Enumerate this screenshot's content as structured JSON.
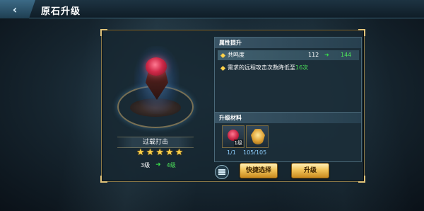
{
  "header": {
    "title": "原石升级",
    "back_glyph": "‹"
  },
  "gem": {
    "skill_name": "过载打击",
    "stars": [
      "★",
      "★",
      "★",
      "★",
      "★"
    ],
    "level_current": "3级",
    "level_next": "4级",
    "arrow_glyph": "➜"
  },
  "attributes": {
    "section_title": "属性提升",
    "row": {
      "name": "共鸣度",
      "current": "112",
      "next": "144"
    },
    "requirement_prefix": "需求的远程攻击次数降低至",
    "requirement_value": "16次"
  },
  "materials": {
    "section_title": "升级材料",
    "items": [
      {
        "badge": "1级",
        "count": "1/1"
      },
      {
        "badge": "",
        "count": "105/105"
      }
    ]
  },
  "buttons": {
    "quick_select": "快捷选择",
    "upgrade": "升级"
  },
  "colors": {
    "accent_gold": "#f2c45a",
    "value_green": "#4de25a",
    "star_gold": "#ffd34a",
    "frame_gold": "#8f7c4a"
  },
  "icons": {
    "back": "back-arrow-icon",
    "list": "list-icon",
    "attr_bullet": "diamond-icon",
    "material_1": "rose-gem-icon",
    "material_2": "gold-crest-icon"
  }
}
